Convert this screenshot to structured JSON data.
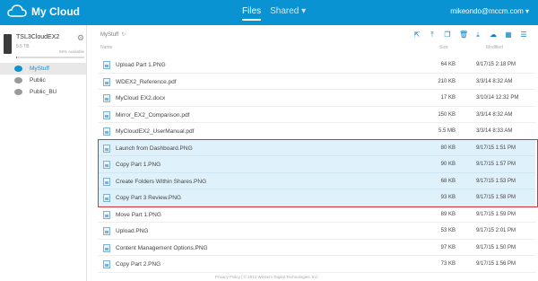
{
  "app": {
    "name": "My Cloud",
    "brand_color": "#0a93d2"
  },
  "nav": {
    "files": "Files",
    "shared": "Shared ▾"
  },
  "user": {
    "email": "mikeondo@mccm.com ▾"
  },
  "device": {
    "name": "TSL3CloudEX2",
    "size": "5.5 TB",
    "available": "99% available",
    "used_fraction": 0.01
  },
  "shares": [
    {
      "label": "MyStuff",
      "active": true
    },
    {
      "label": "Public",
      "active": false
    },
    {
      "label": "Public_BU",
      "active": false
    }
  ],
  "breadcrumb": {
    "path": "MyStuff",
    "refresh_icon": "↻"
  },
  "columns": {
    "name": "Name",
    "size": "Size",
    "modified": "Modified"
  },
  "files": [
    {
      "name": "Upload Part 1.PNG",
      "size": "64 KB",
      "modified": "9/17/15 2:18 PM",
      "selected": false
    },
    {
      "name": "WDEX2_Reference.pdf",
      "size": "210 KB",
      "modified": "3/3/14 8:32 AM",
      "selected": false
    },
    {
      "name": "MyCloud EX2.docx",
      "size": "17 KB",
      "modified": "3/10/14 12:32 PM",
      "selected": false
    },
    {
      "name": "Mirror_EX2_Comparison.pdf",
      "size": "150 KB",
      "modified": "3/3/14 8:32 AM",
      "selected": false
    },
    {
      "name": "MyCloudEX2_UserManual.pdf",
      "size": "5.5 MB",
      "modified": "3/3/14 8:33 AM",
      "selected": false
    },
    {
      "name": "Launch from Dashboard.PNG",
      "size": "80 KB",
      "modified": "9/17/15 1:51 PM",
      "selected": true
    },
    {
      "name": "Copy Part 1.PNG",
      "size": "90 KB",
      "modified": "9/17/15 1:57 PM",
      "selected": true
    },
    {
      "name": "Create Folders Within Shares.PNG",
      "size": "68 KB",
      "modified": "9/17/15 1:53 PM",
      "selected": true
    },
    {
      "name": "Copy Part 3 Review.PNG",
      "size": "93 KB",
      "modified": "9/17/15 1:58 PM",
      "selected": true
    },
    {
      "name": "Move Part 1.PNG",
      "size": "89 KB",
      "modified": "9/17/15 1:59 PM",
      "selected": false
    },
    {
      "name": "Upload.PNG",
      "size": "53 KB",
      "modified": "9/17/15 2:01 PM",
      "selected": false
    },
    {
      "name": "Content Management Options.PNG",
      "size": "97 KB",
      "modified": "9/17/15 1:50 PM",
      "selected": false
    },
    {
      "name": "Copy Part 2.PNG",
      "size": "73 KB",
      "modified": "9/17/15 1:56 PM",
      "selected": false
    }
  ],
  "toolbar_icons": [
    "share-icon",
    "upload-icon",
    "copy-icon",
    "delete-icon",
    "download-icon",
    "cloud-icon",
    "grid-view-icon",
    "list-view-icon"
  ],
  "footer": {
    "text": "Privacy Policy   |   © 2013 Western Digital Technologies, Inc."
  }
}
